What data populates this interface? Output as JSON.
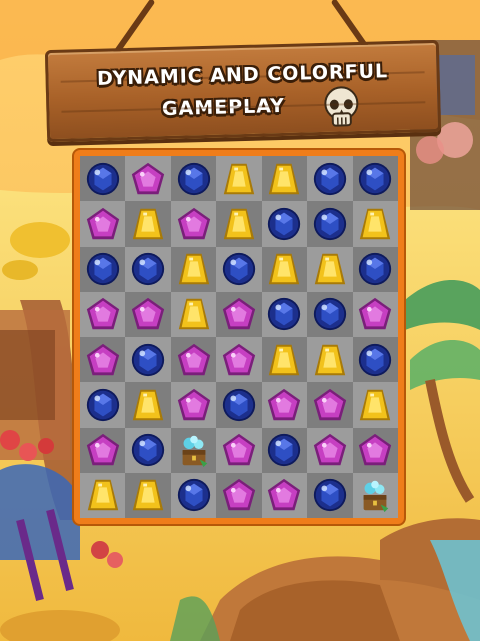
{
  "sign": {
    "line1": "DYNAMIC AND COLORFUL",
    "line2": "GAMEPLAY",
    "emblem_icon": "skull-icon"
  },
  "board": {
    "columns": 7,
    "rows": 8,
    "tiles": [
      [
        "blue-gem",
        "pink-gem",
        "blue-gem",
        "yellow-gem",
        "yellow-gem",
        "blue-gem",
        "blue-gem"
      ],
      [
        "pink-gem",
        "yellow-gem",
        "pink-gem",
        "yellow-gem",
        "blue-gem",
        "blue-gem",
        "yellow-gem"
      ],
      [
        "blue-gem",
        "blue-gem",
        "yellow-gem",
        "blue-gem",
        "yellow-gem",
        "yellow-gem",
        "blue-gem"
      ],
      [
        "pink-gem",
        "pink-gem",
        "yellow-gem",
        "pink-gem",
        "blue-gem",
        "blue-gem",
        "pink-gem"
      ],
      [
        "pink-gem",
        "blue-gem",
        "pink-gem",
        "pink-gem",
        "yellow-gem",
        "yellow-gem",
        "blue-gem"
      ],
      [
        "blue-gem",
        "yellow-gem",
        "pink-gem",
        "blue-gem",
        "pink-gem",
        "pink-gem",
        "yellow-gem"
      ],
      [
        "pink-gem",
        "blue-gem",
        "treasure-icon",
        "pink-gem",
        "blue-gem",
        "pink-gem",
        "pink-gem"
      ],
      [
        "yellow-gem",
        "yellow-gem",
        "blue-gem",
        "pink-gem",
        "pink-gem",
        "blue-gem",
        "treasure-icon"
      ]
    ]
  },
  "colors": {
    "board_border": "#ef7d1a",
    "sign_wood": "#a86128",
    "blue_gem": "#1c2f8c",
    "pink_gem": "#c63fc2",
    "yellow_gem": "#f2c21b"
  }
}
